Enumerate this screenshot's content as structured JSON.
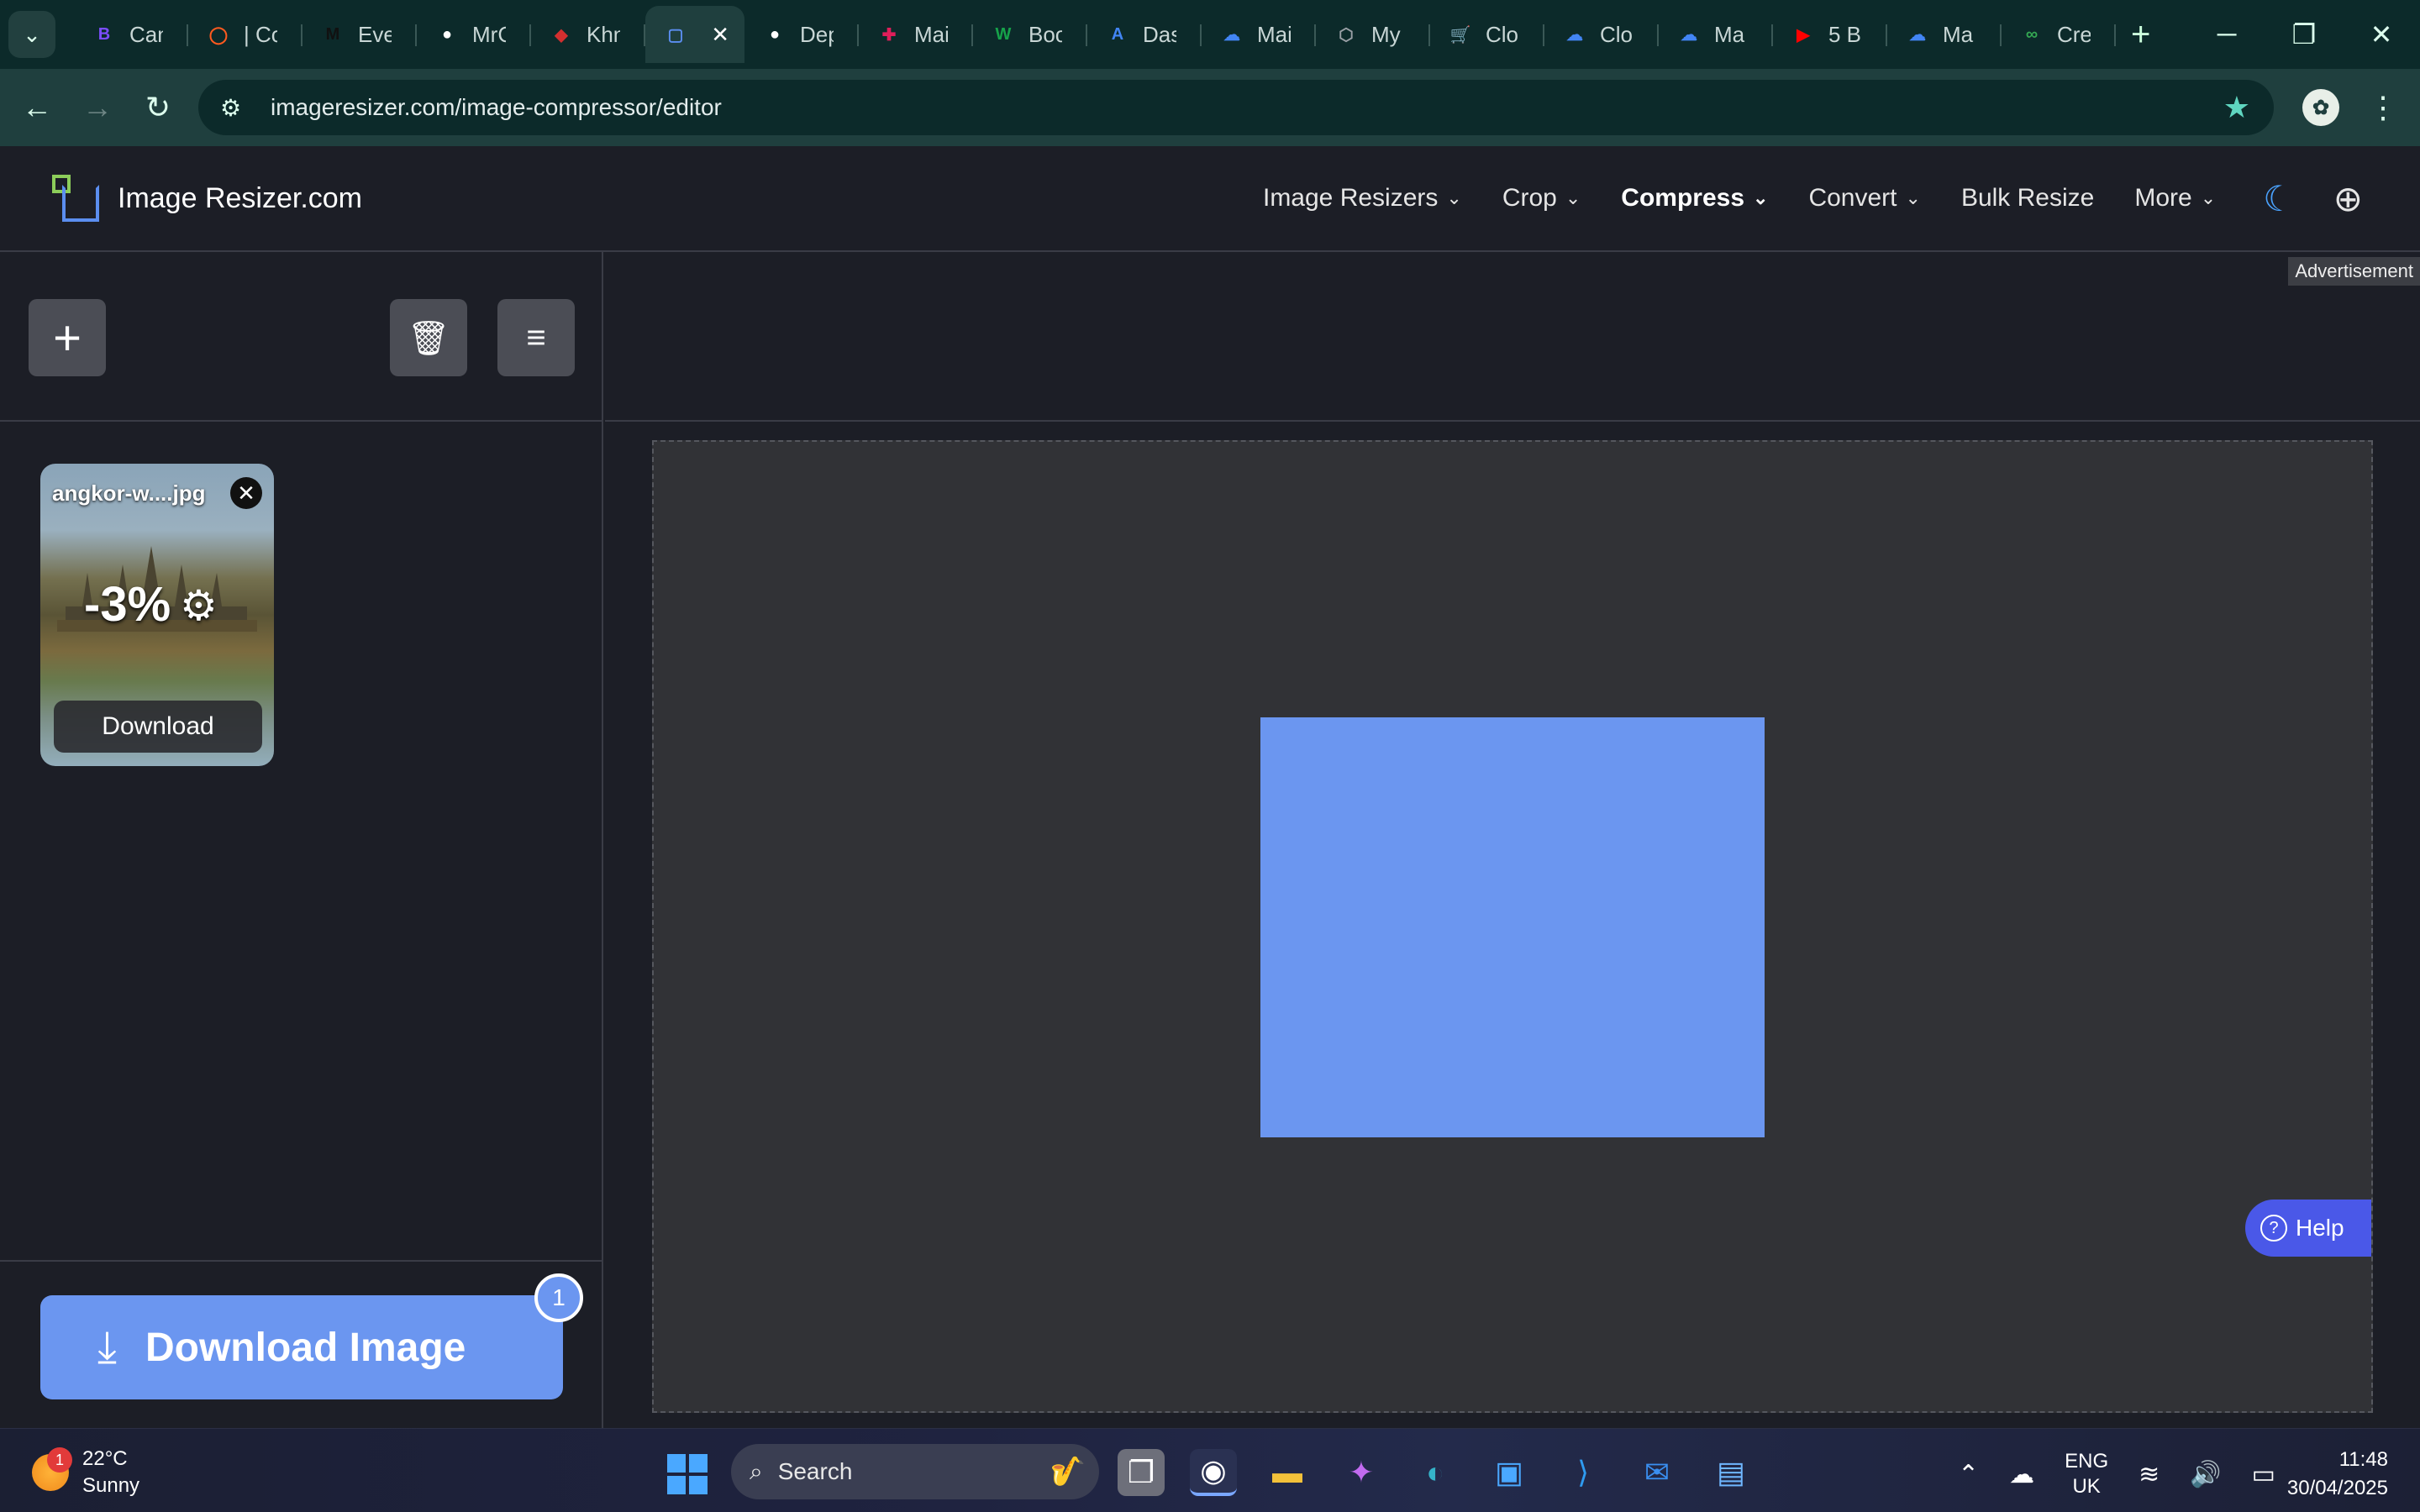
{
  "browser": {
    "tabs": [
      {
        "title": "Can",
        "icon": "b-letter-icon",
        "glyph": "B",
        "color": "#7c4dff"
      },
      {
        "title": "| Co",
        "icon": "ring-icon",
        "glyph": "◯",
        "color": "#ff5a1f"
      },
      {
        "title": "Eve",
        "icon": "m-logo-icon",
        "glyph": "M",
        "color": "#111111"
      },
      {
        "title": "MrC",
        "icon": "github-icon",
        "glyph": "●",
        "color": "#ffffff"
      },
      {
        "title": "Khn",
        "icon": "flag-icon",
        "glyph": "◆",
        "color": "#d32f2f"
      },
      {
        "title": "",
        "icon": "image-resizer-icon",
        "glyph": "▢",
        "color": "#5b8ef0",
        "active": true
      },
      {
        "title": "Dep",
        "icon": "github-icon",
        "glyph": "●",
        "color": "#ffffff"
      },
      {
        "title": "Mai",
        "icon": "slack-icon",
        "glyph": "✚",
        "color": "#e01e5a"
      },
      {
        "title": "Boo",
        "icon": "w-logo-icon",
        "glyph": "W",
        "color": "#16a34a"
      },
      {
        "title": "Das",
        "icon": "translate-icon",
        "glyph": "A",
        "color": "#4285f4"
      },
      {
        "title": "Mai",
        "icon": "cloud-icon",
        "glyph": "☁",
        "color": "#4285f4"
      },
      {
        "title": "My",
        "icon": "hexagon-icon",
        "glyph": "⬡",
        "color": "#9aa0a6"
      },
      {
        "title": "Clo",
        "icon": "cart-icon",
        "glyph": "🛒",
        "color": "#4285f4"
      },
      {
        "title": "Clo",
        "icon": "cloud-icon",
        "glyph": "☁",
        "color": "#4285f4"
      },
      {
        "title": "Ma",
        "icon": "cloud-icon",
        "glyph": "☁",
        "color": "#4285f4"
      },
      {
        "title": "5 B",
        "icon": "youtube-icon",
        "glyph": "▶",
        "color": "#ff0000"
      },
      {
        "title": "Ma",
        "icon": "cloud-icon",
        "glyph": "☁",
        "color": "#4285f4"
      },
      {
        "title": "Cre",
        "icon": "link-icon",
        "glyph": "∞",
        "color": "#34a853"
      }
    ],
    "url": "imageresizer.com/image-compressor/editor"
  },
  "site": {
    "logo_text": "Image Resizer.com",
    "nav": {
      "image_resizers": "Image Resizers",
      "crop": "Crop",
      "compress": "Compress",
      "convert": "Convert",
      "bulk_resize": "Bulk Resize",
      "more": "More"
    },
    "advertisement_label": "Advertisement"
  },
  "editor": {
    "file": {
      "name": "angkor-w....jpg",
      "reduction": "-3%",
      "download_label": "Download"
    },
    "download_image_label": "Download Image",
    "image_count": "1",
    "preview_color": "#6b96f0",
    "help_label": "Help"
  },
  "taskbar": {
    "weather_temp": "22°C",
    "weather_desc": "Sunny",
    "weather_badge": "1",
    "search_placeholder": "Search",
    "lang_1": "ENG",
    "lang_2": "UK",
    "time": "11:48",
    "date": "30/04/2025"
  }
}
